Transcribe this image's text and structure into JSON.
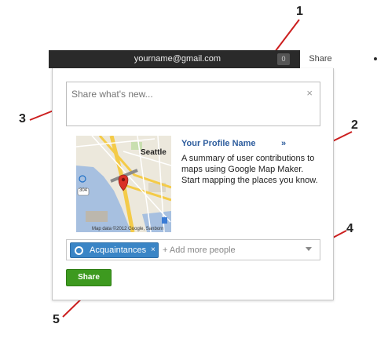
{
  "callouts": [
    "1",
    "2",
    "3",
    "4",
    "5"
  ],
  "topbar": {
    "email": "yourname@gmail.com",
    "notification_count": "0",
    "share_tab": "Share",
    "settings_icon": "gear-icon"
  },
  "share_box": {
    "placeholder": "Share what's new...",
    "close_glyph": "×"
  },
  "card": {
    "map_labels": {
      "seattle": "Seattle",
      "copyright": "Map data ©2012 Google, Sanborn",
      "road_304": "304"
    },
    "profile_name": "Your Profile Name",
    "profile_chevron": "»",
    "summary": "A summary of user contributions to maps using Google Map Maker. Start mapping the places you know."
  },
  "people": {
    "chip_label": "Acquaintances",
    "chip_remove": "×",
    "add_more": "+ Add more people"
  },
  "share_button": "Share",
  "colors": {
    "topbar_bg": "#2a2a2a",
    "chip_blue": "#3a85c6",
    "share_green": "#3d9a1f",
    "link_blue": "#2f5e9e",
    "callout_red": "#cc1f1f"
  }
}
